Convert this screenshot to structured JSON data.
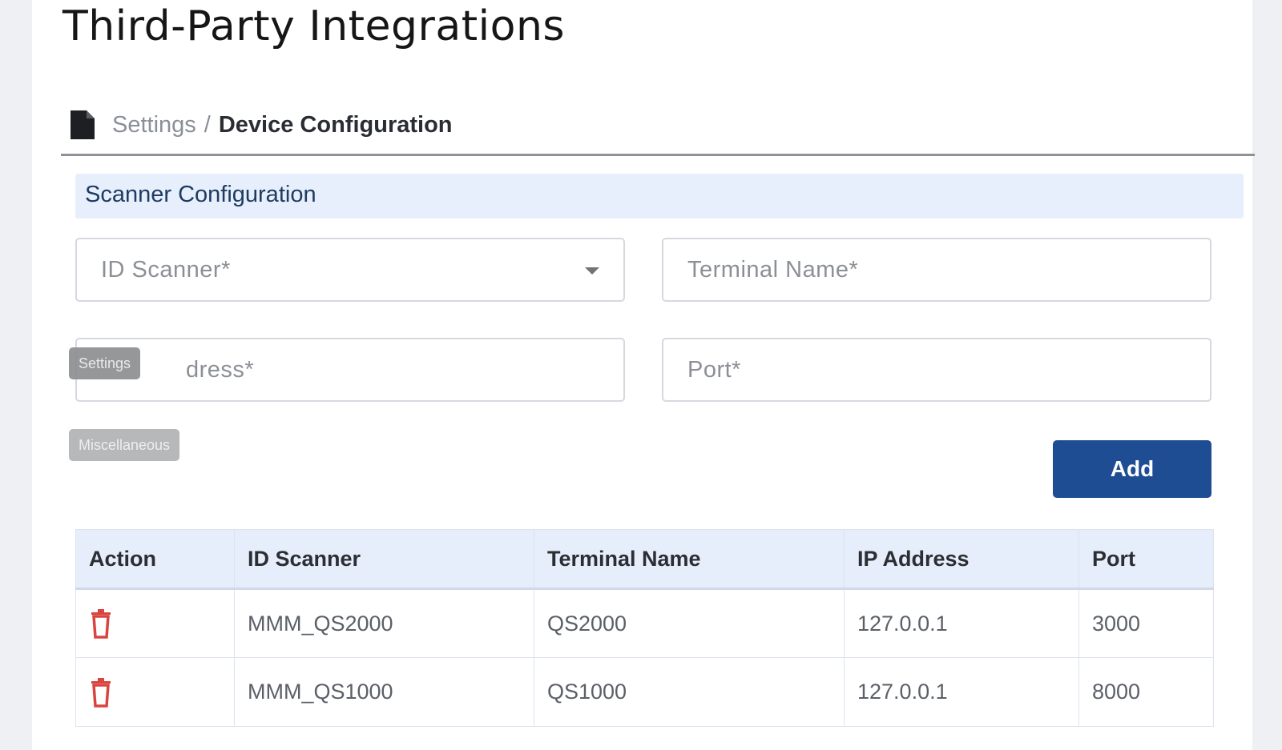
{
  "page": {
    "title": "Third-Party Integrations"
  },
  "breadcrumb": {
    "parent": "Settings",
    "separator": "/",
    "current": "Device Configuration",
    "icon": "document-icon"
  },
  "section": {
    "title": "Scanner Configuration"
  },
  "form": {
    "id_scanner": {
      "placeholder": "ID Scanner*",
      "type": "select",
      "value": ""
    },
    "terminal_name": {
      "placeholder": "Terminal Name*",
      "value": ""
    },
    "ip_address": {
      "placeholder": "IP Address*",
      "visible_text": "dress*",
      "value": ""
    },
    "port": {
      "placeholder": "Port*",
      "value": ""
    },
    "add_label": "Add"
  },
  "tooltips": {
    "settings": "Settings",
    "miscellaneous": "Miscellaneous"
  },
  "table": {
    "columns": [
      "Action",
      "ID Scanner",
      "Terminal Name",
      "IP Address",
      "Port"
    ],
    "rows": [
      {
        "action_icon": "trash-icon",
        "id_scanner": "MMM_QS2000",
        "terminal_name": "QS2000",
        "ip_address": "127.0.0.1",
        "port": "3000"
      },
      {
        "action_icon": "trash-icon",
        "id_scanner": "MMM_QS1000",
        "terminal_name": "QS1000",
        "ip_address": "127.0.0.1",
        "port": "8000"
      }
    ]
  },
  "colors": {
    "accent": "#1f4d93",
    "section_bg": "#e6effb",
    "danger": "#d9443f"
  }
}
